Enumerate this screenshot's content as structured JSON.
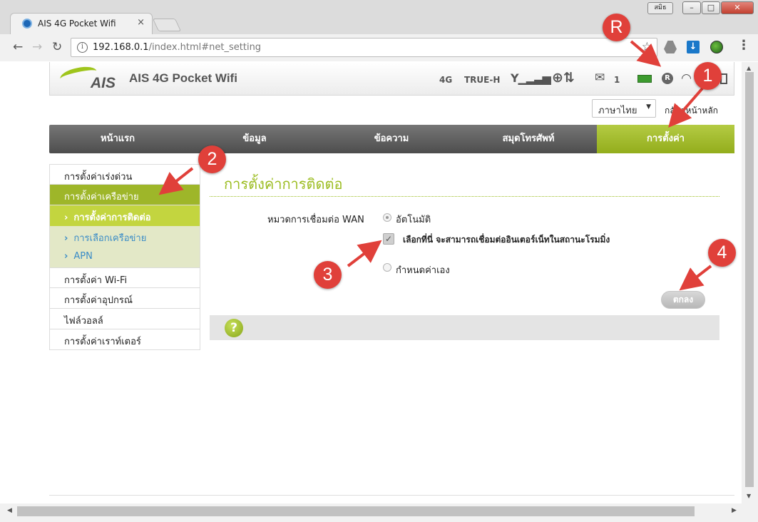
{
  "browser": {
    "tab_title": "AIS 4G Pocket Wifi",
    "tab_close": "×",
    "user_badge": "สมิธ",
    "url_host": "192.168.0.1",
    "url_path": "/index.html#net_setting",
    "window_min": "–",
    "window_max": "□",
    "window_close": "✕"
  },
  "header": {
    "logo_text": "AIS",
    "site_title": "AIS 4G Pocket Wifi",
    "network_type": "4G",
    "carrier": "TRUE-H",
    "unread_messages": "1",
    "roaming_badge": "R"
  },
  "top_controls": {
    "language": "ภาษาไทย",
    "home_link": "กลับสู่หน้าหลัก"
  },
  "main_nav": [
    "หน้าแรก",
    "ข้อมูล",
    "ข้อความ",
    "สมุดโทรศัพท์",
    "การตั้งค่า"
  ],
  "side_menu": {
    "quick_setup": "การตั้งค่าเร่งด่วน",
    "network_settings": "การตั้งค่าเครือข่าย",
    "sub_connection": "การตั้งค่าการติดต่อ",
    "sub_network_select": "การเลือกเครือข่าย",
    "sub_apn": "APN",
    "wifi_settings": "การตั้งค่า Wi-Fi",
    "device_settings": "การตั้งค่าอุปกรณ์",
    "firewall": "ไฟล์วอลล์",
    "router_settings": "การตั้งค่าเราท์เตอร์",
    "chevron": "›"
  },
  "content": {
    "heading": "การตั้งค่าการติดต่อ",
    "wan_label": "หมวดการเชื่อมต่อ WAN",
    "option_auto": "อัตโนมัติ",
    "roaming_checkbox": "เลือกที่นี่ จะสามารถเชื่อมต่ออินเตอร์เน็ทในสถานะโรมมิ่ง",
    "option_manual": "กำหนดค่าเอง",
    "ok_button": "ตกลง",
    "help": "?"
  },
  "annotations": [
    "R",
    "1",
    "2",
    "3",
    "4"
  ],
  "colors": {
    "accent_green": "#9cbd22",
    "nav_dark": "#5a5a5a",
    "callout_red": "#e0403a"
  }
}
